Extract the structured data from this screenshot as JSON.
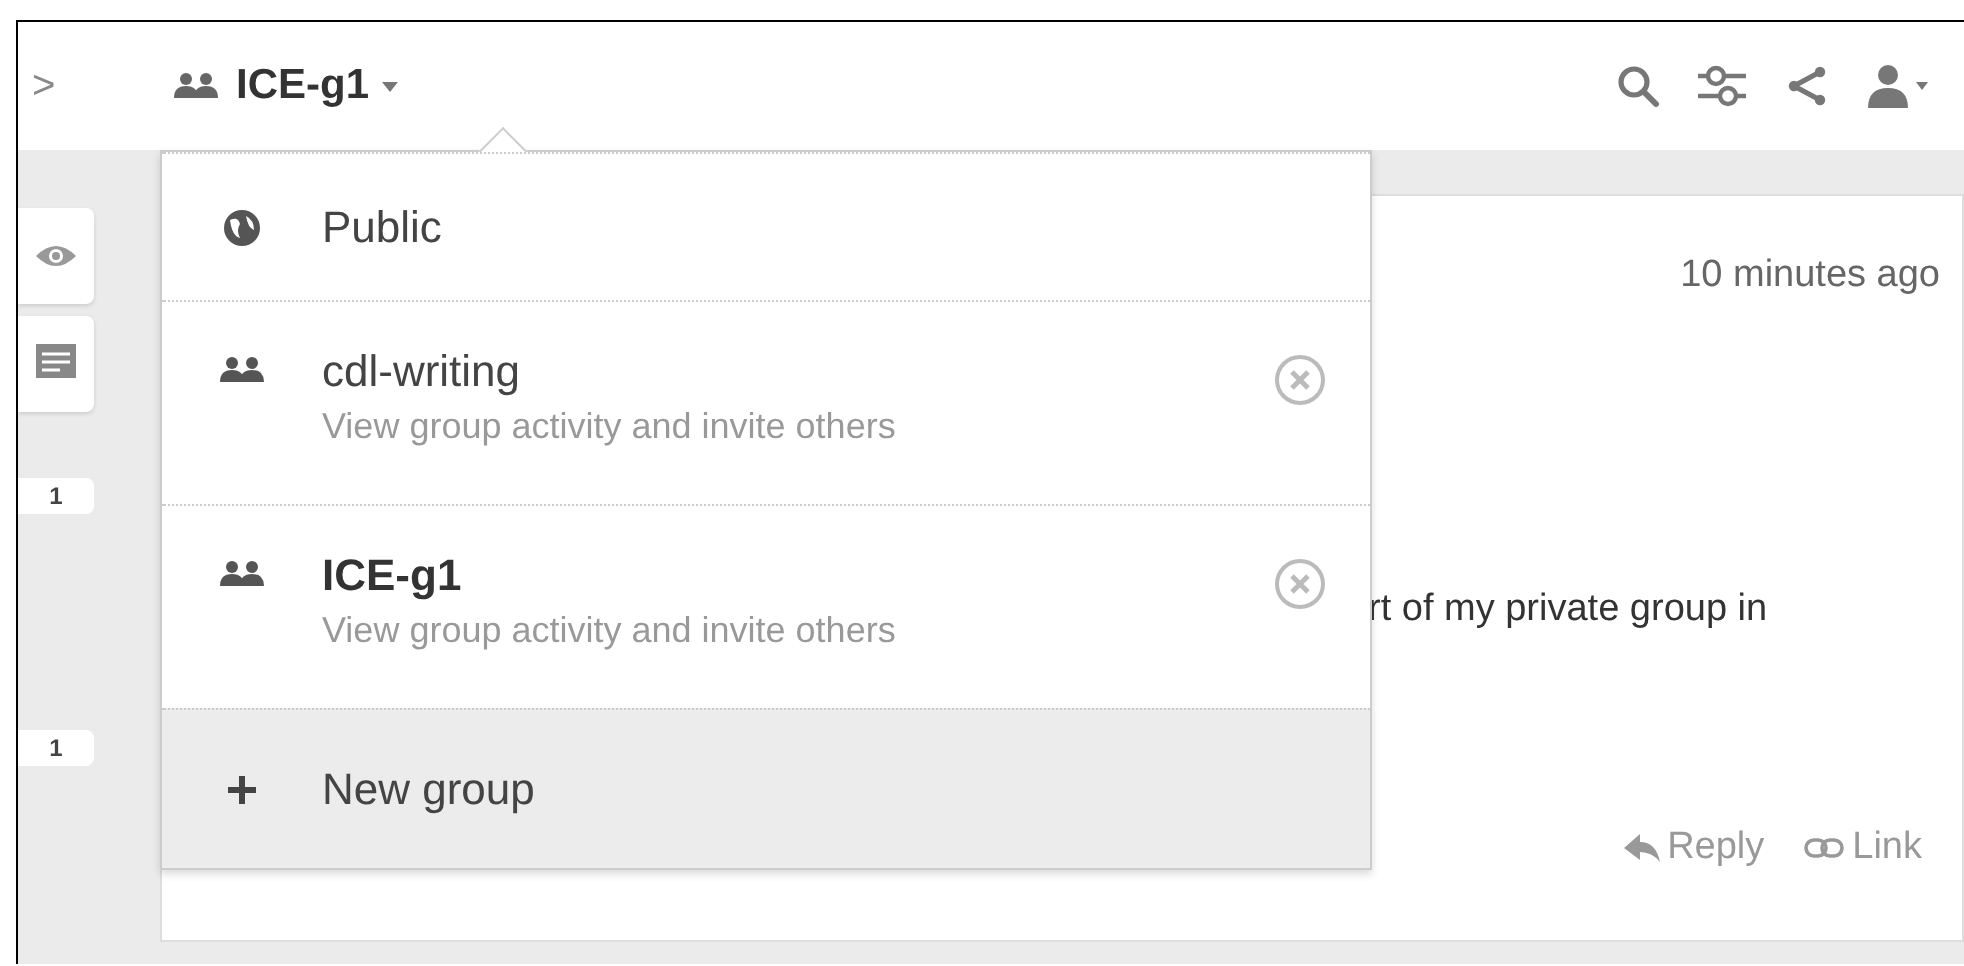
{
  "header": {
    "back_arrow": ">",
    "group_name": "ICE-g1"
  },
  "sidebar": {
    "badges": [
      "1",
      "1"
    ]
  },
  "annotation": {
    "time": "10 minutes ago",
    "text": "rt of my private group in",
    "actions": [
      {
        "kind": "reply",
        "label": "Reply"
      },
      {
        "kind": "link",
        "label": "Link"
      }
    ]
  },
  "dropdown": {
    "items": [
      {
        "kind": "public",
        "label": "Public",
        "selected": false,
        "highlighted": false
      },
      {
        "kind": "group",
        "label": "cdl-writing",
        "description": "View group activity and invite others",
        "selected": false,
        "highlighted": false
      },
      {
        "kind": "group",
        "label": "ICE-g1",
        "description": "View group activity and invite others",
        "selected": true,
        "highlighted": false
      },
      {
        "kind": "new",
        "label": "New group",
        "selected": false,
        "highlighted": true
      }
    ]
  }
}
